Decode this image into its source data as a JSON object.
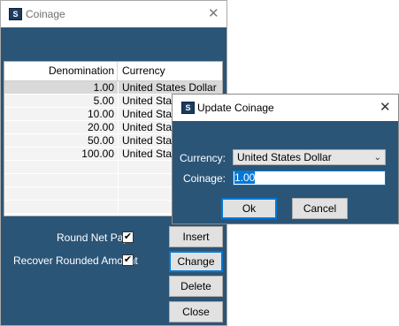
{
  "main_window": {
    "title": "Coinage",
    "app_icon_glyph": "S",
    "close_glyph": "✕",
    "grid": {
      "columns": [
        "Denomination",
        "Currency"
      ],
      "rows": [
        {
          "denomination": "1.00",
          "currency": "United States Dollar"
        },
        {
          "denomination": "5.00",
          "currency": "United States Dollar"
        },
        {
          "denomination": "10.00",
          "currency": "United States Dollar"
        },
        {
          "denomination": "20.00",
          "currency": "United States Dollar"
        },
        {
          "denomination": "50.00",
          "currency": "United States Dollar"
        },
        {
          "denomination": "100.00",
          "currency": "United States Dollar"
        }
      ]
    },
    "options": {
      "round_net_pay_label": "Round Net Pay",
      "round_net_pay_checked": true,
      "recover_rounded_label": "Recover Rounded Amount",
      "recover_rounded_checked": true,
      "check_glyph": "✔"
    },
    "buttons": {
      "insert": "Insert",
      "change": "Change",
      "delete": "Delete",
      "close": "Close"
    }
  },
  "dialog": {
    "title": "Update Coinage",
    "app_icon_glyph": "S",
    "close_glyph": "✕",
    "currency_label": "Currency:",
    "currency_value": "United States Dollar",
    "chevron_glyph": "⌄",
    "coinage_label": "Coinage:",
    "coinage_value": "1.00",
    "ok": "Ok",
    "cancel": "Cancel"
  },
  "colors": {
    "window_bg": "#2b5577",
    "accent": "#0078d7"
  }
}
